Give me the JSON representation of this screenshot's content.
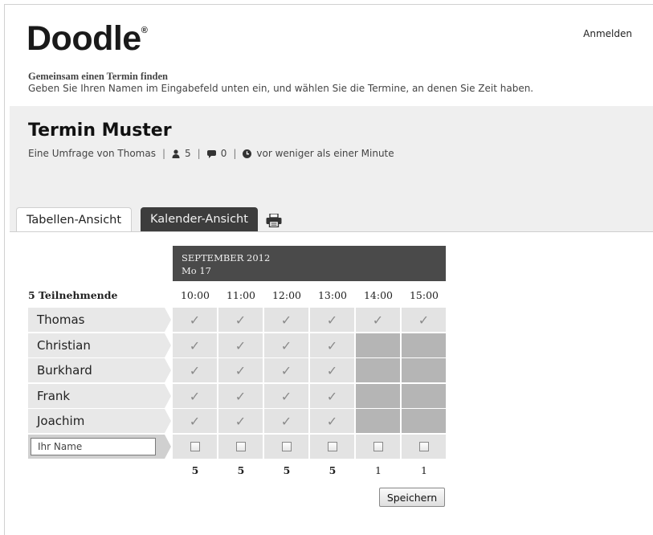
{
  "header": {
    "logo": "Doodle",
    "logo_mark": "®",
    "login_link": "Anmelden",
    "tagline_title": "Gemeinsam einen Termin finden",
    "tagline_subtitle": "Geben Sie Ihren Namen im Eingabefeld unten ein, und wählen Sie die Termine, an denen Sie Zeit haben."
  },
  "poll": {
    "title": "Termin Muster",
    "author_text": "Eine Umfrage von Thomas",
    "participants_count": "5",
    "comments_count": "0",
    "updated_text": "vor weniger als einer Minute",
    "icons": {
      "participants": "person-icon",
      "comments": "speech-bubble-icon",
      "updated": "clock-icon",
      "print": "printer-icon"
    }
  },
  "tabs": [
    {
      "label": "Tabellen-Ansicht",
      "active": true
    },
    {
      "label": "Kalender-Ansicht",
      "active": false
    }
  ],
  "table": {
    "month": "SEPTEMBER 2012",
    "day": "Mo 17",
    "participants_label": "5 Teilnehmende",
    "times": [
      "10:00",
      "11:00",
      "12:00",
      "13:00",
      "14:00",
      "15:00"
    ],
    "rows": [
      {
        "name": "Thomas",
        "votes": [
          true,
          true,
          true,
          true,
          true,
          true
        ]
      },
      {
        "name": "Christian",
        "votes": [
          true,
          true,
          true,
          true,
          false,
          false
        ]
      },
      {
        "name": "Burkhard",
        "votes": [
          true,
          true,
          true,
          true,
          false,
          false
        ]
      },
      {
        "name": "Frank",
        "votes": [
          true,
          true,
          true,
          true,
          false,
          false
        ]
      },
      {
        "name": "Joachim",
        "votes": [
          true,
          true,
          true,
          true,
          false,
          false
        ]
      }
    ],
    "yes_mark": "✓",
    "name_input_placeholder": "Ihr Name",
    "totals": [
      "5",
      "5",
      "5",
      "5",
      "1",
      "1"
    ]
  },
  "actions": {
    "save_label": "Speichern"
  }
}
